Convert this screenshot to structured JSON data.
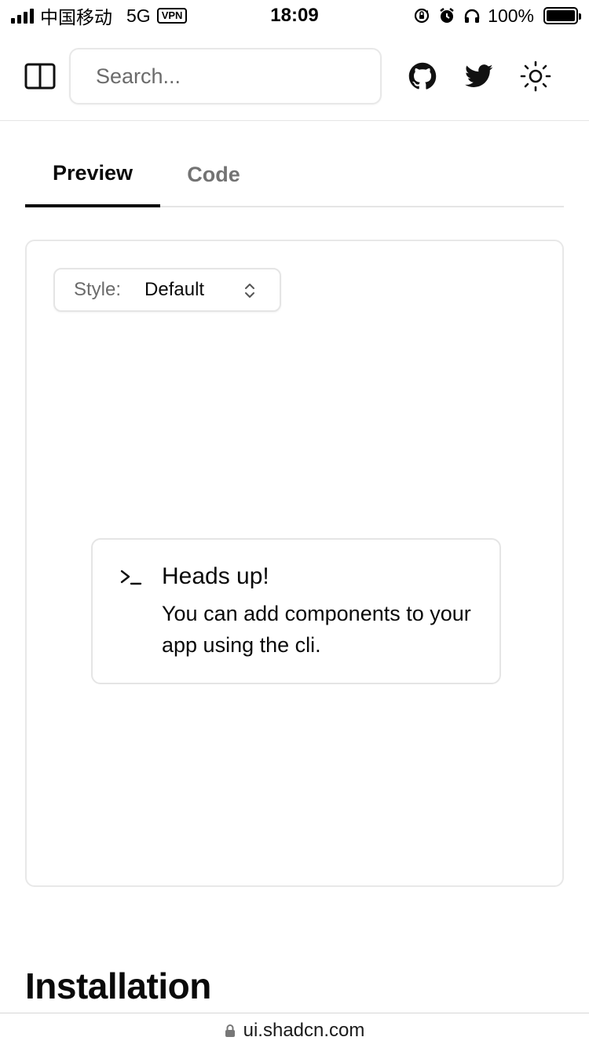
{
  "status_bar": {
    "carrier": "中国移动",
    "network": "5G",
    "vpn": "VPN",
    "time": "18:09",
    "battery": "100%",
    "battery_level": 1.0
  },
  "header": {
    "search_placeholder": "Search...",
    "icons": [
      "sidebar-toggle-icon",
      "github-icon",
      "twitter-icon",
      "sun-icon"
    ]
  },
  "tabs": [
    {
      "label": "Preview",
      "active": true
    },
    {
      "label": "Code",
      "active": false
    }
  ],
  "preview": {
    "style_label": "Style:",
    "style_value": "Default",
    "alert": {
      "title": "Heads up!",
      "description": "You can add components to your app using the cli."
    }
  },
  "section_heading": "Installation",
  "url_bar": {
    "url": "ui.shadcn.com"
  }
}
